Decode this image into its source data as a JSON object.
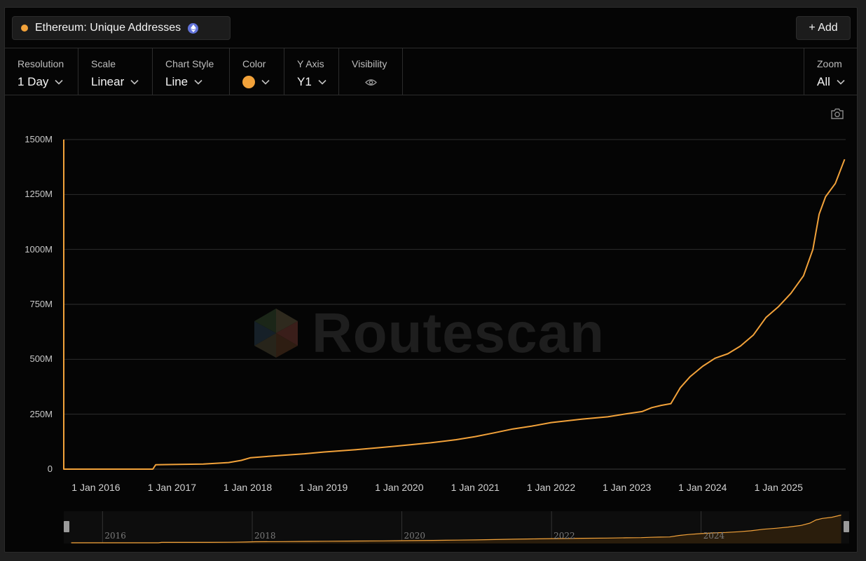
{
  "series": {
    "title": "Ethereum: Unique Addresses",
    "color": "#f2a23a"
  },
  "header": {
    "add_label": "+ Add"
  },
  "toolbar": {
    "resolution": {
      "label": "Resolution",
      "value": "1 Day"
    },
    "scale": {
      "label": "Scale",
      "value": "Linear"
    },
    "chart_style": {
      "label": "Chart Style",
      "value": "Line"
    },
    "color": {
      "label": "Color",
      "swatch": "#f2a23a"
    },
    "y_axis": {
      "label": "Y Axis",
      "value": "Y1"
    },
    "visibility": {
      "label": "Visibility"
    },
    "zoom": {
      "label": "Zoom",
      "value": "All"
    }
  },
  "watermark": {
    "text": "Routescan"
  },
  "navigator": {
    "years": [
      "2016",
      "2018",
      "2020",
      "2022",
      "2024"
    ]
  },
  "chart_data": {
    "type": "line",
    "title": "",
    "xlabel": "",
    "ylabel": "",
    "ylim": [
      0,
      1500
    ],
    "y_unit": "M",
    "y_ticks": [
      "0",
      "250M",
      "500M",
      "750M",
      "1000M",
      "1250M",
      "1500M"
    ],
    "x_ticks": [
      "1 Jan 2016",
      "1 Jan 2017",
      "1 Jan 2018",
      "1 Jan 2019",
      "1 Jan 2020",
      "1 Jan 2021",
      "1 Jan 2022",
      "1 Jan 2023",
      "1 Jan 2024",
      "1 Jan 2025"
    ],
    "grid": true,
    "series": [
      {
        "color": "#f2a23a",
        "points": [
          [
            "2015-07-30",
            1500
          ],
          [
            "2015-07-30",
            0
          ],
          [
            "2015-08-01",
            0
          ],
          [
            "2016-10-01",
            0
          ],
          [
            "2016-10-15",
            20
          ],
          [
            "2017-01-01",
            21
          ],
          [
            "2017-06-01",
            23
          ],
          [
            "2017-10-01",
            30
          ],
          [
            "2017-12-01",
            40
          ],
          [
            "2018-01-15",
            52
          ],
          [
            "2018-06-01",
            62
          ],
          [
            "2018-10-01",
            70
          ],
          [
            "2019-01-01",
            78
          ],
          [
            "2019-06-01",
            88
          ],
          [
            "2019-10-01",
            98
          ],
          [
            "2020-01-01",
            106
          ],
          [
            "2020-06-01",
            120
          ],
          [
            "2020-10-01",
            134
          ],
          [
            "2021-01-01",
            148
          ],
          [
            "2021-04-01",
            165
          ],
          [
            "2021-07-01",
            183
          ],
          [
            "2021-10-01",
            196
          ],
          [
            "2022-01-01",
            212
          ],
          [
            "2022-06-01",
            228
          ],
          [
            "2022-10-01",
            238
          ],
          [
            "2023-01-01",
            252
          ],
          [
            "2023-03-15",
            262
          ],
          [
            "2023-05-01",
            280
          ],
          [
            "2023-06-15",
            290
          ],
          [
            "2023-08-01",
            298
          ],
          [
            "2023-09-15",
            370
          ],
          [
            "2023-11-01",
            420
          ],
          [
            "2024-01-01",
            468
          ],
          [
            "2024-03-01",
            505
          ],
          [
            "2024-05-01",
            525
          ],
          [
            "2024-07-01",
            560
          ],
          [
            "2024-09-01",
            610
          ],
          [
            "2024-11-01",
            690
          ],
          [
            "2025-01-01",
            740
          ],
          [
            "2025-03-01",
            800
          ],
          [
            "2025-05-01",
            880
          ],
          [
            "2025-06-15",
            1000
          ],
          [
            "2025-07-15",
            1160
          ],
          [
            "2025-08-15",
            1240
          ],
          [
            "2025-10-01",
            1300
          ],
          [
            "2025-11-15",
            1410
          ]
        ]
      }
    ]
  }
}
